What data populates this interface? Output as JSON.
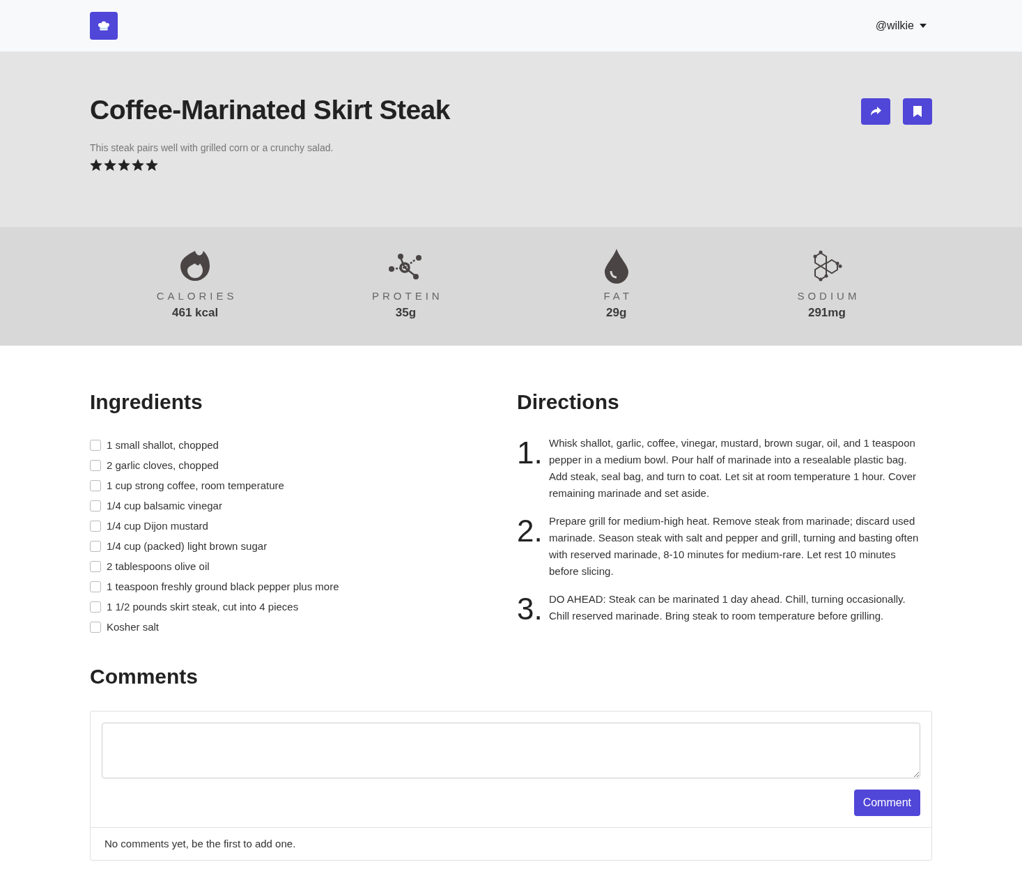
{
  "header": {
    "username": "@wilkie"
  },
  "recipe": {
    "title": "Coffee-Marinated Skirt Steak",
    "description": "This steak pairs well with grilled corn or a crunchy salad.",
    "stars": 5
  },
  "nutrition": [
    {
      "kind": "calories",
      "label": "CALORIES",
      "value": "461 kcal"
    },
    {
      "kind": "protein",
      "label": "PROTEIN",
      "value": "35g"
    },
    {
      "kind": "fat",
      "label": "FAT",
      "value": "29g"
    },
    {
      "kind": "sodium",
      "label": "SODIUM",
      "value": "291mg"
    }
  ],
  "ingredients": {
    "heading": "Ingredients",
    "items": [
      {
        "text": "1 small shallot, chopped",
        "checked": false
      },
      {
        "text": "2 garlic cloves, chopped",
        "checked": false
      },
      {
        "text": "1 cup strong coffee, room temperature",
        "checked": false
      },
      {
        "text": "1/4 cup balsamic vinegar",
        "checked": false
      },
      {
        "text": "1/4 cup Dijon mustard",
        "checked": false
      },
      {
        "text": "1/4 cup (packed) light brown sugar",
        "checked": false
      },
      {
        "text": "2 tablespoons olive oil",
        "checked": false
      },
      {
        "text": "1 teaspoon freshly ground black pepper plus more",
        "checked": false
      },
      {
        "text": "1 1/2 pounds skirt steak, cut into 4 pieces",
        "checked": false
      },
      {
        "text": "Kosher salt",
        "checked": false
      }
    ]
  },
  "directions": {
    "heading": "Directions",
    "steps": [
      {
        "number": "1.",
        "text": "Whisk shallot, garlic, coffee, vinegar, mustard, brown sugar, oil, and 1 teaspoon pepper in a medium bowl. Pour half of marinade into a resealable plastic bag. Add steak, seal bag, and turn to coat. Let sit at room temperature 1 hour. Cover remaining marinade and set aside."
      },
      {
        "number": "2.",
        "text": "Prepare grill for medium-high heat. Remove steak from marinade; discard used marinade. Season steak with salt and pepper and grill, turning and basting often with reserved marinade, 8-10 minutes for medium-rare. Let rest 10 minutes before slicing."
      },
      {
        "number": "3.",
        "text": "DO AHEAD: Steak can be marinated 1 day ahead. Chill, turning occasionally. Chill reserved marinade. Bring steak to room temperature before grilling."
      }
    ]
  },
  "comments": {
    "heading": "Comments",
    "button": "Comment",
    "empty_message": "No comments yet, be the first to add one."
  }
}
